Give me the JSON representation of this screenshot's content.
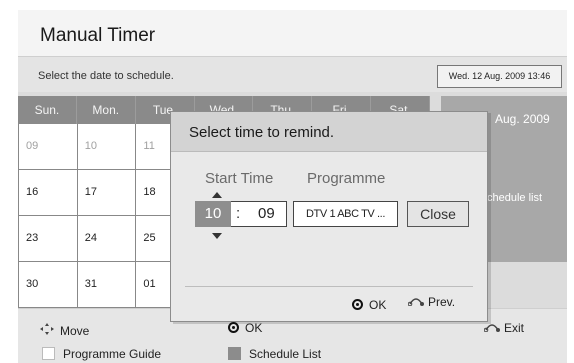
{
  "title": "Manual Timer",
  "info": {
    "instruction": "Select the date to schedule.",
    "current_datetime": "Wed. 12 Aug. 2009 13:46"
  },
  "calendar": {
    "weekdays": [
      "Sun.",
      "Mon.",
      "Tue.",
      "Wed.",
      "Thu.",
      "Fri.",
      "Sat."
    ],
    "rows": [
      [
        {
          "d": "09",
          "dim": true
        },
        {
          "d": "10",
          "dim": true
        },
        {
          "d": "11",
          "dim": true
        },
        {
          "d": "",
          "dim": false
        },
        {
          "d": "",
          "dim": false
        },
        {
          "d": "",
          "dim": false
        },
        {
          "d": "",
          "dim": false
        }
      ],
      [
        {
          "d": "16",
          "dim": false
        },
        {
          "d": "17",
          "dim": false
        },
        {
          "d": "18",
          "dim": false
        },
        {
          "d": "",
          "dim": false
        },
        {
          "d": "",
          "dim": false
        },
        {
          "d": "",
          "dim": false
        },
        {
          "d": "",
          "dim": false
        }
      ],
      [
        {
          "d": "23",
          "dim": false
        },
        {
          "d": "24",
          "dim": false
        },
        {
          "d": "25",
          "dim": false
        },
        {
          "d": "",
          "dim": false
        },
        {
          "d": "",
          "dim": false
        },
        {
          "d": "",
          "dim": false
        },
        {
          "d": "",
          "dim": false
        }
      ],
      [
        {
          "d": "30",
          "dim": false
        },
        {
          "d": "31",
          "dim": false
        },
        {
          "d": "01",
          "dim": false
        },
        {
          "d": "",
          "dim": false
        },
        {
          "d": "",
          "dim": false
        },
        {
          "d": "",
          "dim": false
        },
        {
          "d": "",
          "dim": false
        }
      ]
    ]
  },
  "side_panel": {
    "month": "Aug. 2009",
    "list_label": "chedule list"
  },
  "dialog": {
    "title": "Select time to remind.",
    "start_time_label": "Start Time",
    "programme_label": "Programme",
    "hour": "10",
    "separator": ":",
    "minute": "09",
    "programme_value": "DTV 1 ABC TV ...",
    "close_label": "Close",
    "ok_label": "OK",
    "prev_label": "Prev."
  },
  "footer": {
    "move_label": "Move",
    "ok_label": "OK",
    "exit_label": "Exit",
    "programme_guide_label": "Programme Guide",
    "schedule_list_label": "Schedule List"
  },
  "icons": {
    "move": "four-way-arrow-icon",
    "ok": "ok-button-icon",
    "exit": "return-icon",
    "prev": "return-icon",
    "time_up": "arrow-up-icon",
    "time_down": "arrow-down-icon"
  },
  "colors": {
    "calendar_header": "#8a8a8a",
    "highlight": "#8e8e8e",
    "side_panel": "#a8a8a8",
    "programme_guide_swatch": "#ffffff",
    "schedule_list_swatch": "#8c8c8c"
  }
}
